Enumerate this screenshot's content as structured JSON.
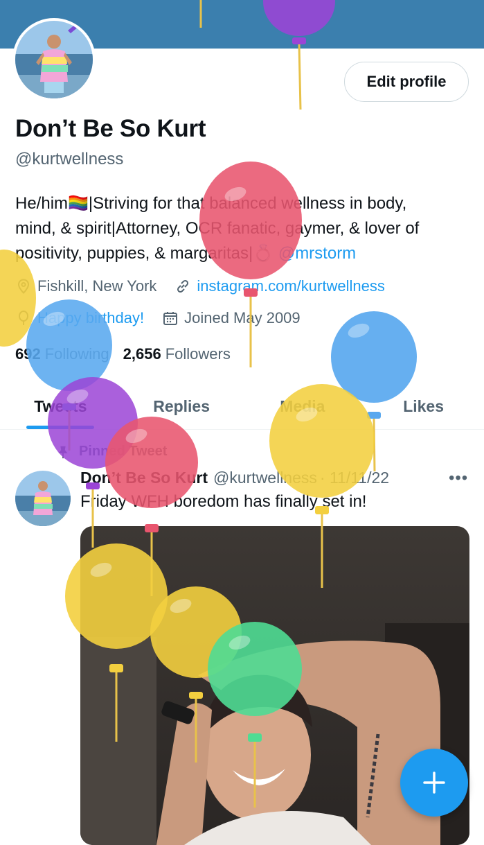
{
  "profile": {
    "name": "Don’t Be So Kurt",
    "handle": "@kurtwellness",
    "edit_button": "Edit profile",
    "bio": {
      "line1": "He/him🏳️‍🌈|Striving for that balanced wellness in body,",
      "line2": "mind, & spirit|Attorney, OCR fanatic, gaymer, & lover of",
      "line3_text": "positivity, puppies, & margaritas|💍",
      "line3_link": "@mrstorm"
    },
    "location": "Fishkill, New York",
    "website": "instagram.com/kurtwellness",
    "birthday": "Happy birthday!",
    "joined": "Joined May 2009",
    "following_count": "692",
    "following_label": "Following",
    "followers_count": "2,656",
    "followers_label": "Followers"
  },
  "tabs": [
    {
      "label": "Tweets",
      "active": true
    },
    {
      "label": "Replies",
      "active": false
    },
    {
      "label": "Media",
      "active": false
    },
    {
      "label": "Likes",
      "active": false
    }
  ],
  "tweet": {
    "pinned_label": "Pinned Tweet",
    "author_name": "Don’t Be So Kurt",
    "author_handle": "@kurtwellness",
    "date": "· 11/11/22",
    "more": "•••",
    "text": "Friday WFH boredom has finally set in!"
  },
  "icons": {
    "location": "location-pin-icon",
    "website": "link-icon",
    "birthday": "balloon-icon",
    "joined": "calendar-icon",
    "pinned": "pin-icon",
    "fab": "plus-icon"
  },
  "colors": {
    "banner": "#3b7fae",
    "accent": "#1d9bf0",
    "text": "#0f1419",
    "secondary": "#536471",
    "balloon_red": "#e8556e",
    "balloon_yellow": "#f3cf3f",
    "balloon_blue": "#59a8ef",
    "balloon_purple": "#9b44d6",
    "balloon_green": "#4fdc93"
  }
}
